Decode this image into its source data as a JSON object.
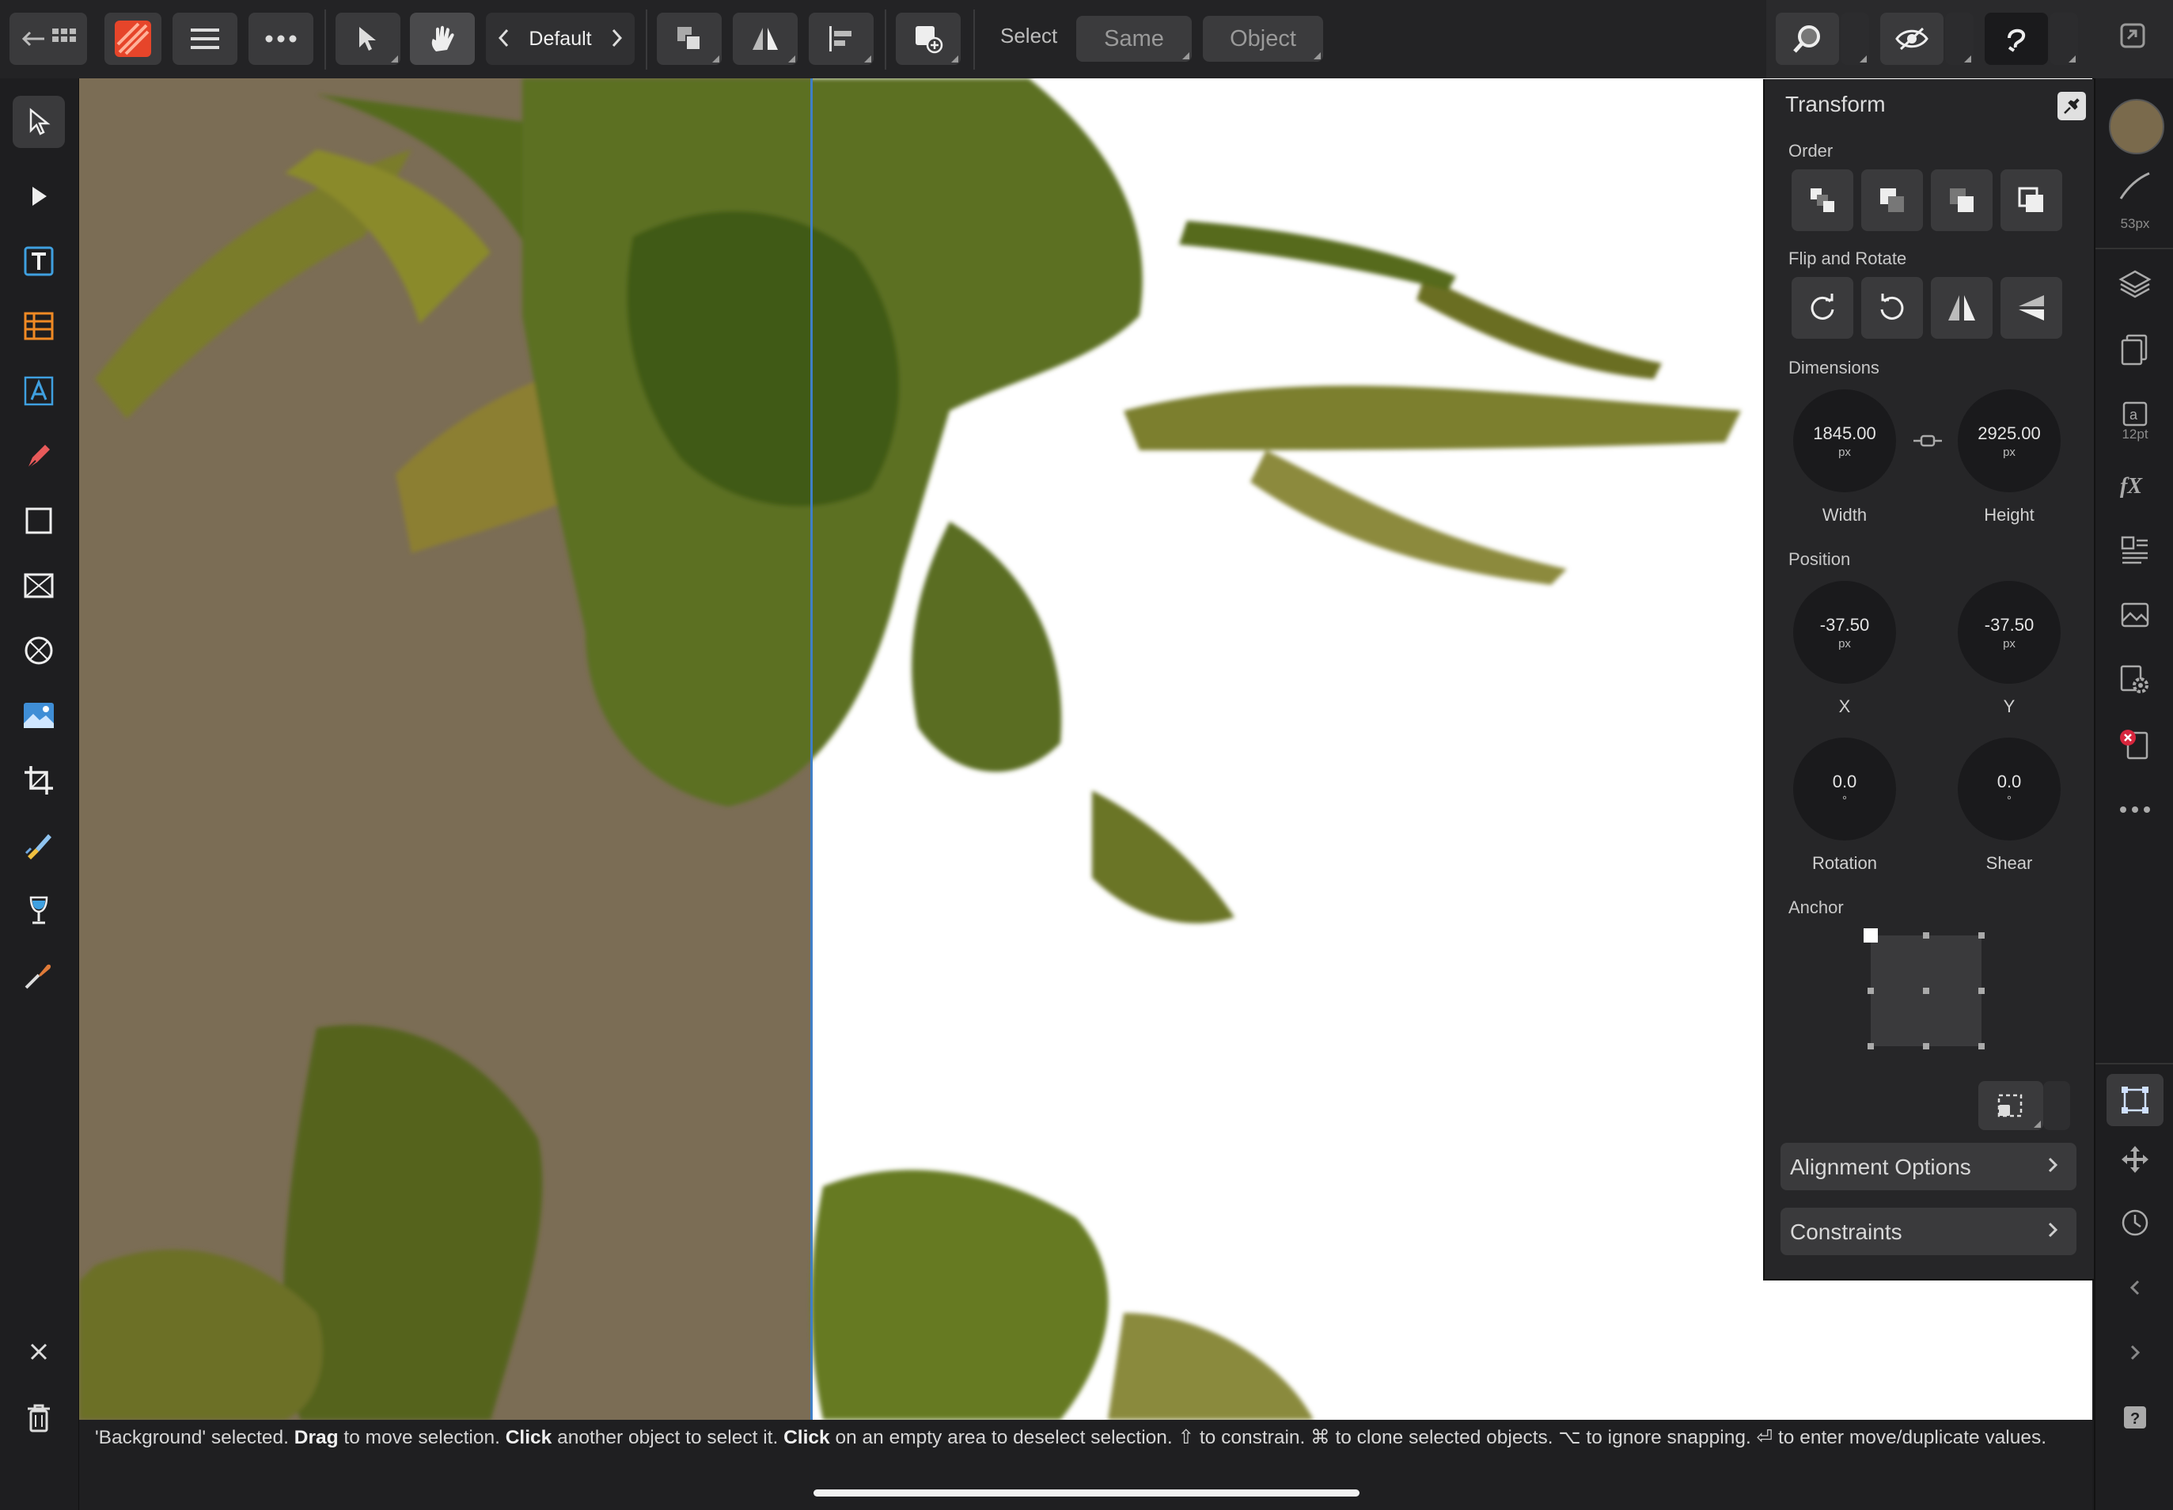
{
  "toolbar": {
    "persona_name": "Default",
    "select_label": "Select",
    "same_button": "Same",
    "object_button": "Object"
  },
  "transform_panel": {
    "title": "Transform",
    "order_label": "Order",
    "flip_rotate_label": "Flip and Rotate",
    "dimensions_label": "Dimensions",
    "width": {
      "value": "1845.00",
      "unit": "px",
      "label": "Width"
    },
    "height": {
      "value": "2925.00",
      "unit": "px",
      "label": "Height"
    },
    "position_label": "Position",
    "x": {
      "value": "-37.50",
      "unit": "px",
      "label": "X"
    },
    "y": {
      "value": "-37.50",
      "unit": "px",
      "label": "Y"
    },
    "rotation": {
      "value": "0.0",
      "unit": "°",
      "label": "Rotation"
    },
    "shear": {
      "value": "0.0",
      "unit": "°",
      "label": "Shear"
    },
    "anchor_label": "Anchor",
    "alignment_options": "Alignment Options",
    "constraints": "Constraints"
  },
  "right_studio": {
    "brush_size": "53px",
    "text_size": "12pt"
  },
  "status": {
    "selected_name": "'Background'",
    "t1": " selected. ",
    "b1": "Drag",
    "t2": " to move selection. ",
    "b2": "Click",
    "t3": " another object to select it. ",
    "b3": "Click",
    "t4": " on an empty area to deselect selection. ⇧ to constrain. ⌘ to clone selected objects. ⌥ to ignore snapping. ⏎ to enter move/duplicate values."
  },
  "colors": {
    "accent_orange": "#e6452a",
    "guide_blue": "#3f7fc7",
    "background_layer": "#7b6d55",
    "foliage_green": "#5f7321",
    "current_color": "#7a6a4c",
    "close_red": "#d7263d"
  },
  "icons": {
    "top": [
      "back-arrow-icon",
      "grid-icon",
      "app-logo-icon",
      "menu-icon",
      "more-icon",
      "move-tool-icon",
      "hand-gesture-icon",
      "chevron-left-icon",
      "chevron-right-icon",
      "arrange-icon",
      "flip-icon",
      "align-icon",
      "insert-object-icon",
      "magnifier-icon",
      "eye-icon",
      "assistant-icon",
      "fullscreen-icon"
    ],
    "left": [
      "move-tool-icon",
      "node-tool-icon",
      "frame-text-icon",
      "table-icon",
      "artistic-text-icon",
      "pen-tool-icon",
      "rectangle-tool-icon",
      "picture-frame-icon",
      "ellipse-frame-icon",
      "place-image-icon",
      "crop-tool-icon",
      "paintbrush-icon",
      "fill-tool-icon",
      "color-picker-icon",
      "close-icon",
      "trash-icon"
    ],
    "right": [
      "color-swatch-icon",
      "stroke-icon",
      "layers-icon",
      "pages-icon",
      "text-style-icon",
      "fx-icon",
      "text-frame-icon",
      "stock-icon",
      "settings-icon",
      "preflight-icon",
      "more-icon",
      "transform-icon",
      "navigator-icon",
      "history-icon",
      "chevron-left-icon",
      "chevron-right-icon",
      "help-icon"
    ]
  }
}
